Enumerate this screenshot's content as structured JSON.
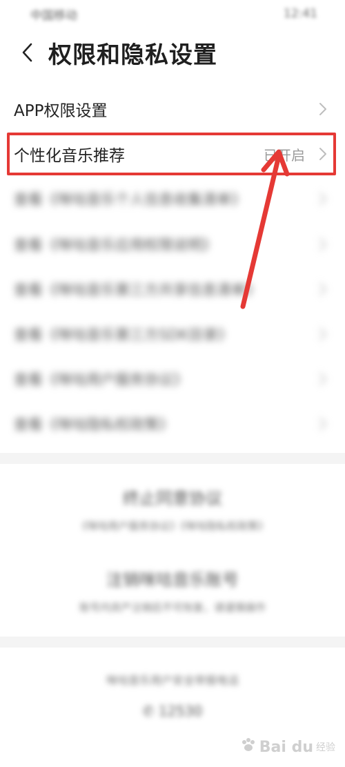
{
  "status_bar": {
    "carrier": "中国移动",
    "time": "12:41"
  },
  "header": {
    "title": "权限和隐私设置"
  },
  "settings": {
    "app_permission": "APP权限设置",
    "personalized": {
      "label": "个性化音乐推荐",
      "value": "已开启"
    },
    "blurred_items": [
      "查看《咪咕音乐个人信息收集清单》",
      "查看《咪咕音乐应用权限说明》",
      "查看《咪咕音乐第三方共享信息清单》",
      "查看《咪咕音乐第三方SDK目录》",
      "查看《咪咕用户服务协议》",
      "查看《咪咕隐私权政策》"
    ]
  },
  "agreement": {
    "title": "终止同意协议",
    "subtitle": "《咪咕用户服务协议》《咪咕隐私权政策》"
  },
  "account": {
    "title": "注销咪咕音乐账号",
    "subtitle": "账号内资产注销后不可恢复，请谨慎操作"
  },
  "hotline": {
    "label": "咪咕音乐用户安全举报电话",
    "number": "12530"
  },
  "watermark": {
    "brand": "Bai du",
    "sub": "经验"
  },
  "colors": {
    "highlight": "#e53935",
    "arrow": "#e53935"
  }
}
